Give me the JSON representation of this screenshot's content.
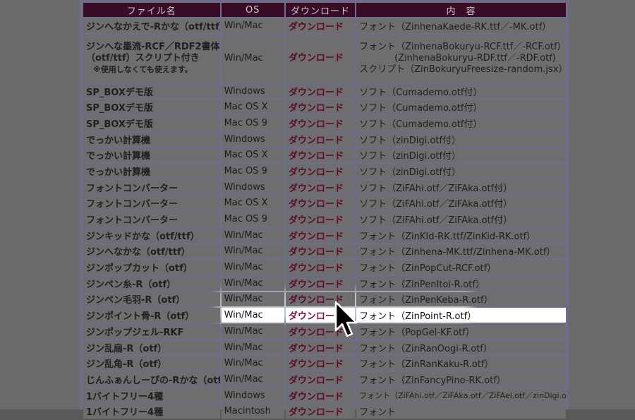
{
  "headers": [
    "ファイル名",
    "OS",
    "ダウンロード",
    "内　容"
  ],
  "rows": [
    {
      "name": "ジンへなかえで-Rかな（otf/ttf）",
      "os": "Win/Mac",
      "dl": "ダウンロード",
      "content": "フォント（ZinhenaKaede-RK.ttf／-MK.otf）"
    },
    {
      "name_lines": [
        "ジンへな墨流-RCF／RDF2書体",
        "（otf/ttf）スクリプト付き",
        "※使用しなくても使えます。"
      ],
      "os": "Win/Mac",
      "dl": "ダウンロード",
      "content_lines": [
        "フォント（ZinhenaBokuryu-RCF.ttf／-RCF.otf）",
        "(ZinhenaBokuryu-RDF.ttf／-RDF.otf)",
        "スクリプト（ZinBokuryuFreesize-random.jsx）"
      ]
    },
    {
      "name": "SP_BOXデモ版",
      "os": "Windows",
      "dl": "ダウンロード",
      "content": "ソフト（Cumademo.otf付）"
    },
    {
      "name": "SP_BOXデモ版",
      "os": "Mac OS X",
      "dl": "ダウンロード",
      "content": "ソフト（Cumademo.otf付）"
    },
    {
      "name": "SP_BOXデモ版",
      "os": "Mac OS 9",
      "dl": "ダウンロード",
      "content": "ソフト（Cumademo.otf付）"
    },
    {
      "name": "でっかい計算機",
      "os": "Windows",
      "dl": "ダウンロード",
      "content": "ソフト（zinDigi.otf付）"
    },
    {
      "name": "でっかい計算機",
      "os": "Mac OS X",
      "dl": "ダウンロード",
      "content": "ソフト（zinDigi.otf付）"
    },
    {
      "name": "でっかい計算機",
      "os": "Mac OS 9",
      "dl": "ダウンロード",
      "content": "ソフト（zinDigi.otf付）"
    },
    {
      "name": "フォントコンバーター",
      "os": "Windows",
      "dl": "ダウンロード",
      "content": "ソフト（ZiFAhi.otf／ZiFAka.otf付）"
    },
    {
      "name": "フォントコンバーター",
      "os": "Mac OS X",
      "dl": "ダウンロード",
      "content": "ソフト（ZiFAhi.otf／ZiFAka.otf付）"
    },
    {
      "name": "フォントコンバーター",
      "os": "Mac OS 9",
      "dl": "ダウンロード",
      "content": "ソフト（ZiFAhi.otf／ZiFAka.otf付）"
    },
    {
      "name": "ジンキッドかな（otf/ttf）",
      "os": "Win/Mac",
      "dl": "ダウンロード",
      "content": "フォント（ZinKId-RK.ttf/ZinKid-RK.otf）"
    },
    {
      "name": "ジンへなかな（otf/ttf）",
      "os": "Win/Mac",
      "dl": "ダウンロード",
      "content": "フォント（Zinhena-MK.ttf/Zinhena-MK.otf）"
    },
    {
      "name": "ジンポップカット（otf）",
      "os": "Win/Mac",
      "dl": "ダウンロード",
      "content": "フォント（ZinPopCut-RCF.otf）"
    },
    {
      "name": "ジンペン糸-R（otf）",
      "os": "Win/Mac",
      "dl": "ダウンロード",
      "content": "フォント（ZinPenItoi-R.otf）"
    },
    {
      "name": "ジンペン毛羽-R（otf）",
      "os": "Win/Mac",
      "dl": "ダウンロード",
      "content": "フォント（ZinPenKeba-R.otf）"
    },
    {
      "name": "ジンポイント骨-R（otf）",
      "os": "Win/Mac",
      "dl": "ダウンロード",
      "content": "フォント（ZinPoint-R.otf）",
      "highlight": true
    },
    {
      "name": "ジンポップジェル-RKF",
      "os": "Win/Mac",
      "dl": "ダウンロード",
      "content": "フォント（PopGel-KF.otf）"
    },
    {
      "name": "ジン乱扇-R（otf）",
      "os": "Win/Mac",
      "dl": "ダウンロード",
      "content": "フォント（ZinRanOogi-R.otf）"
    },
    {
      "name": "ジン乱角-R（otf）",
      "os": "Win/Mac",
      "dl": "ダウンロード",
      "content": "フォント（ZinRanKaku-R.otf）"
    },
    {
      "name": "じんふぁんしーぴの-Rかな（otf）",
      "os": "Win/Mac",
      "dl": "ダウンロード",
      "content": "フォント（ZinFancyPino-RK.otf）"
    },
    {
      "name": "1バイトフリー4種",
      "os": "Windows",
      "dl": "ダウンロード",
      "content": "フォント（ZiFAhi.otf／ZiFAka.otf／ZiFAei.otf／zinDigi.otf）",
      "small": true
    },
    {
      "name": "1バイトフリー4種",
      "os": "Macintosh",
      "dl": "ダウンロード",
      "content": "フォント"
    }
  ],
  "colors": {
    "header_bg": "#3a0d26",
    "frame": "#6e6e8c",
    "download_text": "#5a0a2e",
    "highlight": "#ffffff"
  },
  "cursor": {
    "icon": "arrow-cursor-icon"
  }
}
